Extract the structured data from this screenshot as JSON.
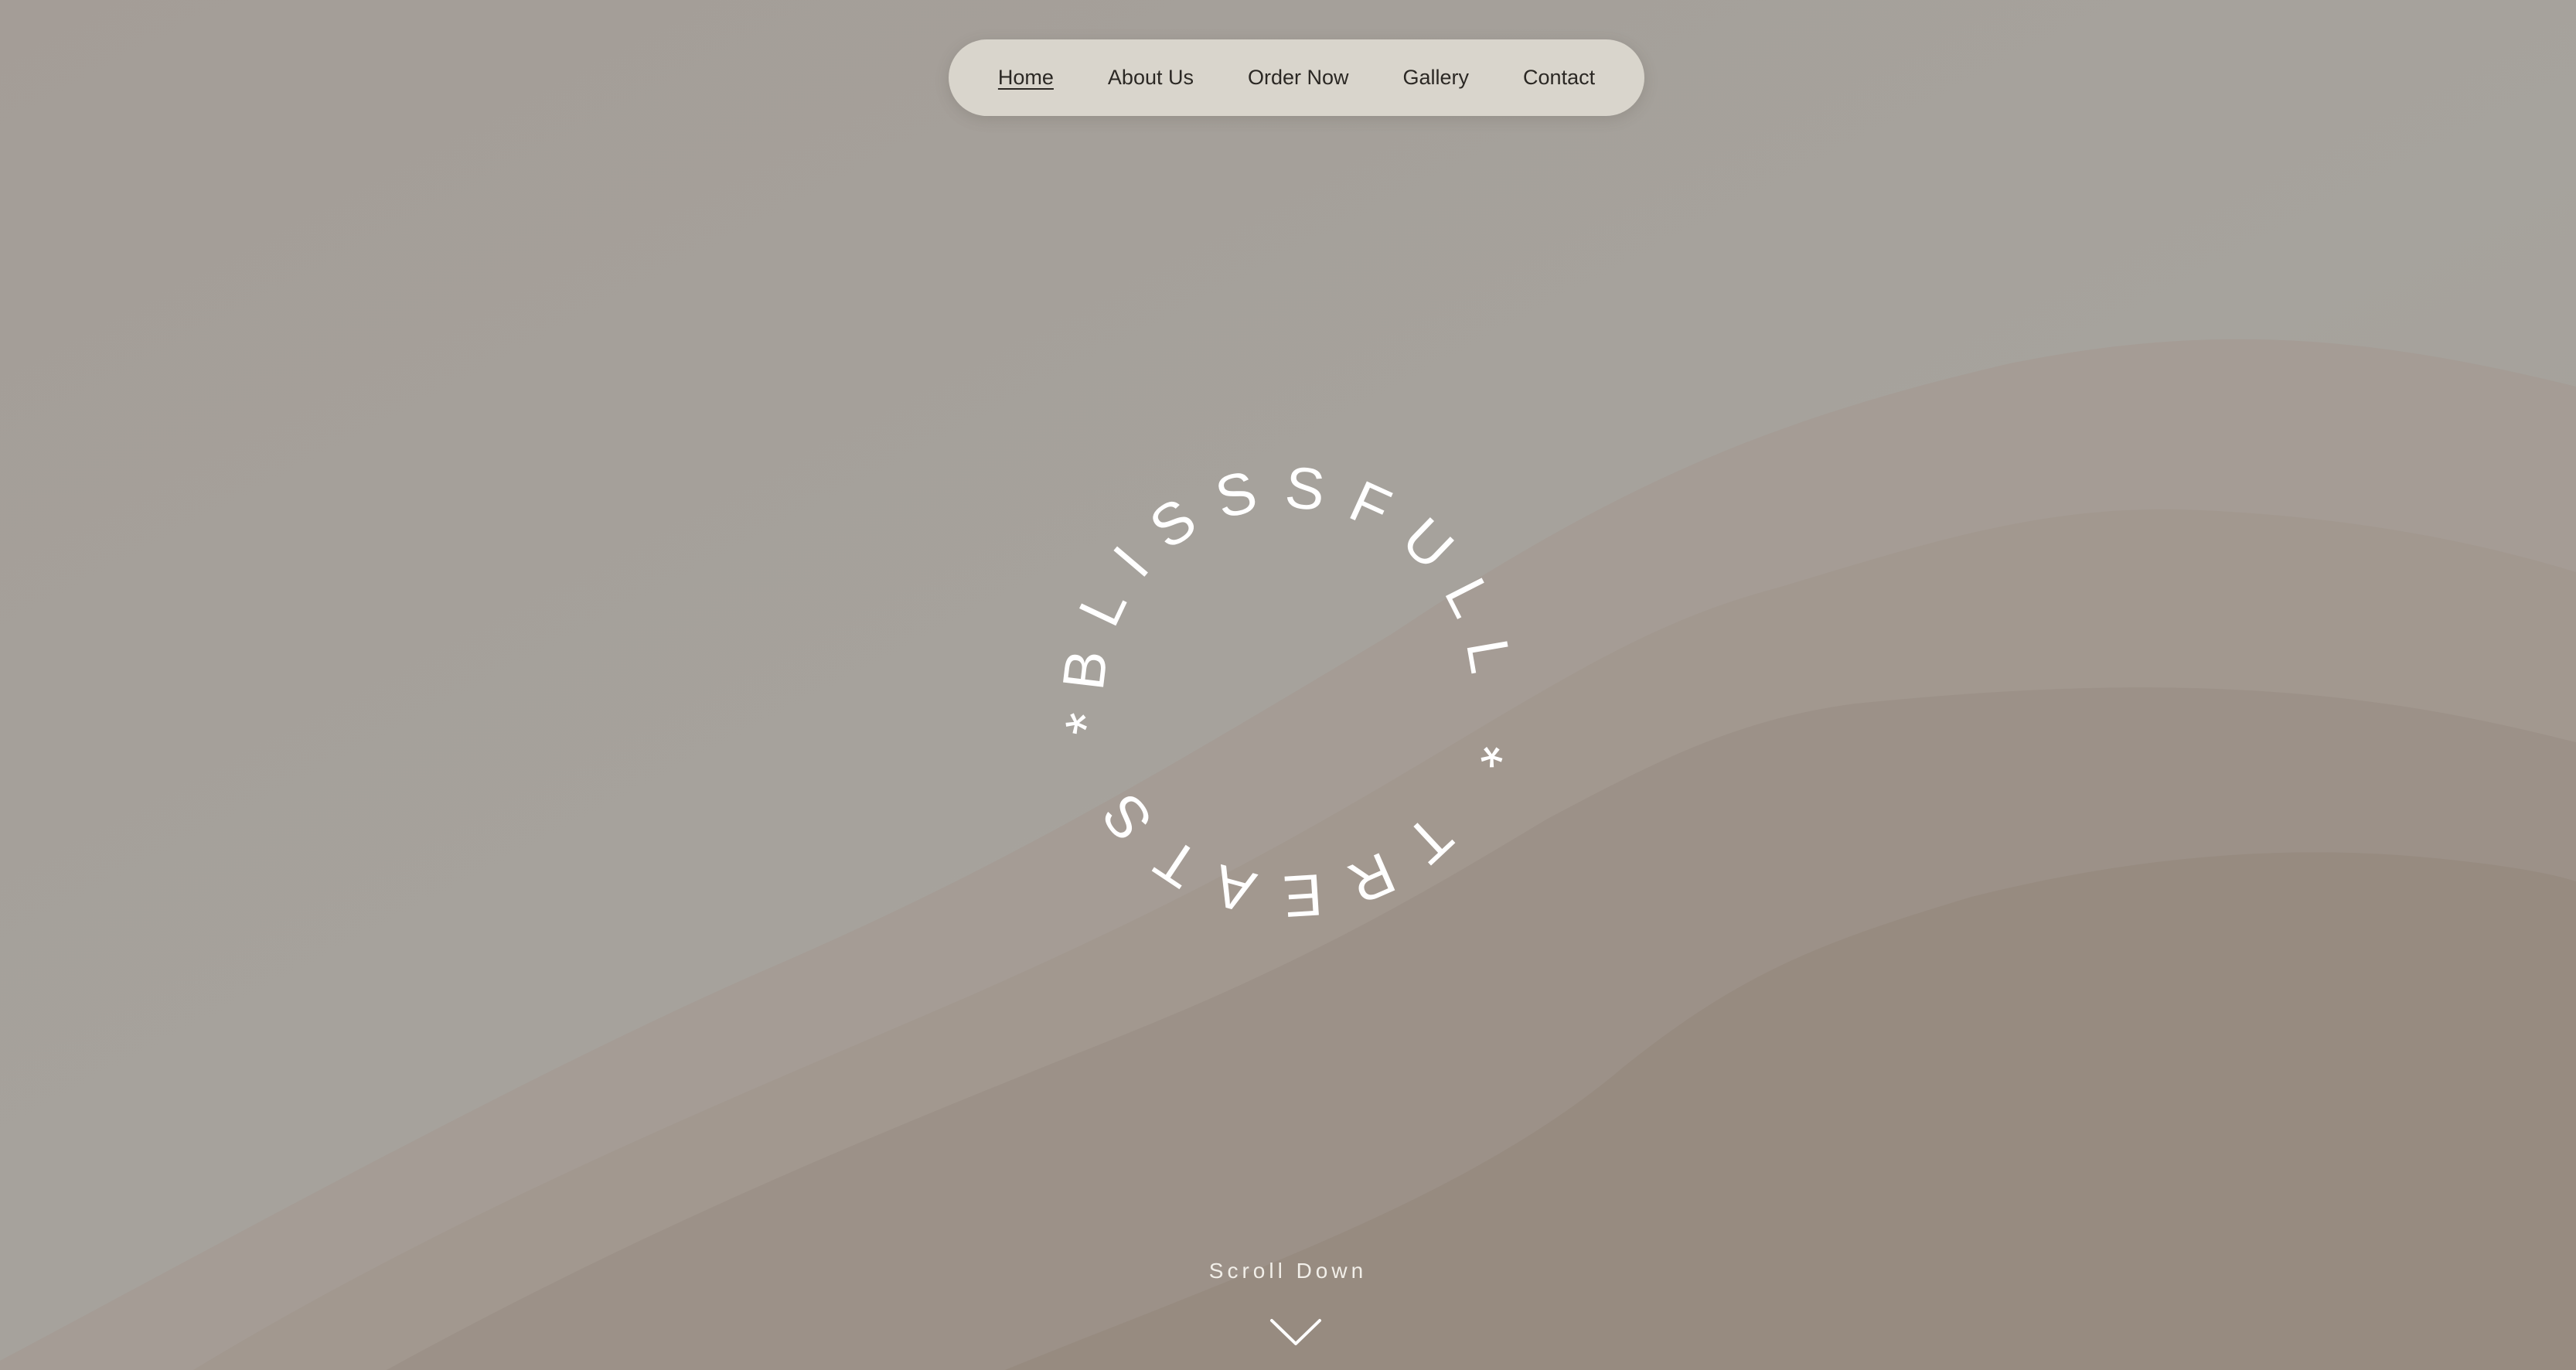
{
  "nav": {
    "items": [
      {
        "label": "Home",
        "active": true
      },
      {
        "label": "About Us",
        "active": false
      },
      {
        "label": "Order Now",
        "active": false
      },
      {
        "label": "Gallery",
        "active": false
      },
      {
        "label": "Contact",
        "active": false
      }
    ]
  },
  "logo": {
    "circle_text": "BLISSSFULL * TREATS *"
  },
  "hero": {
    "scroll_label": "Scroll Down",
    "scroll_icon": "chevron-down-icon"
  },
  "colors": {
    "background": "#a7a39c",
    "hill_light": "#a59a92",
    "hill_mid": "#9f948b",
    "hill_dark": "#978b80",
    "nav_pill": "#d9d5cc",
    "text_light": "#ffffff"
  }
}
